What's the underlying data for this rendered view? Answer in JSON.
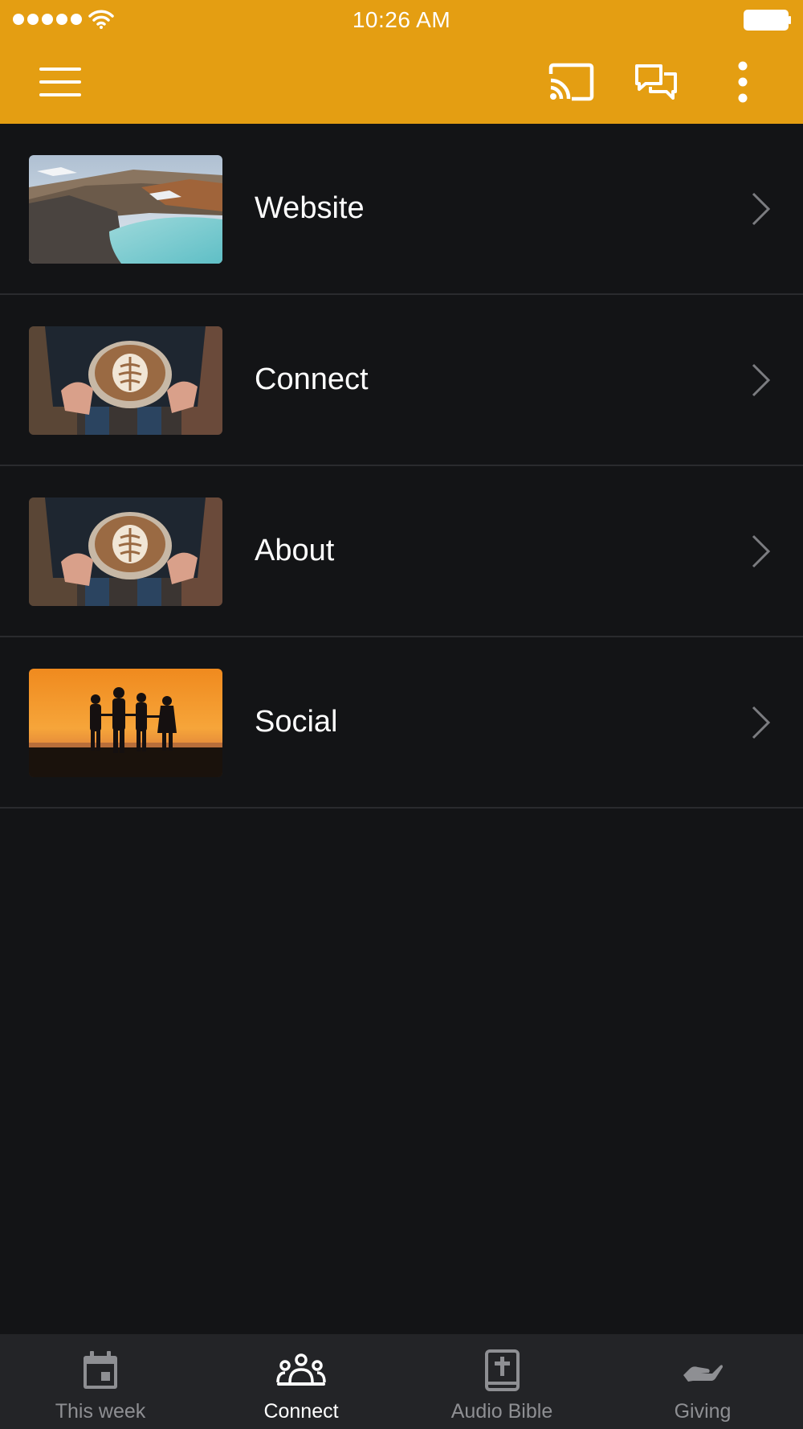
{
  "status_bar": {
    "time": "10:26 AM"
  },
  "toolbar": {
    "menu_icon": "hamburger-icon",
    "cast_icon": "cast-icon",
    "chat_icon": "chat-bubbles-icon",
    "more_icon": "more-vertical-icon"
  },
  "list": {
    "items": [
      {
        "label": "Website",
        "thumbnail": "crater-lake-landscape"
      },
      {
        "label": "Connect",
        "thumbnail": "latte-cup-in-hands"
      },
      {
        "label": "About",
        "thumbnail": "latte-cup-in-hands"
      },
      {
        "label": "Social",
        "thumbnail": "sunset-silhouette-group"
      }
    ]
  },
  "bottom_nav": {
    "items": [
      {
        "label": "This week",
        "icon": "calendar-icon",
        "active": false
      },
      {
        "label": "Connect",
        "icon": "people-group-icon",
        "active": true
      },
      {
        "label": "Audio Bible",
        "icon": "bible-book-icon",
        "active": false
      },
      {
        "label": "Giving",
        "icon": "giving-hand-icon",
        "active": false
      }
    ]
  },
  "colors": {
    "accent": "#E49E12",
    "background": "#131416",
    "nav_background": "#232427",
    "divider": "#2A2B2E",
    "nav_inactive": "#8E8F93",
    "nav_active": "#FFFFFF"
  }
}
